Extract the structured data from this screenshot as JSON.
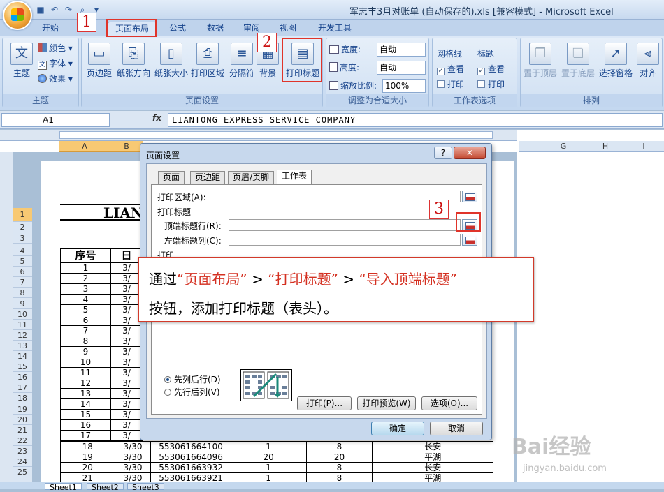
{
  "window": {
    "title": "军志丰3月对账单 (自动保存的).xls  [兼容模式] - Microsoft Excel"
  },
  "tabs": [
    "开始",
    "页面布局",
    "公式",
    "数据",
    "审阅",
    "视图",
    "开发工具"
  ],
  "active_tab": "页面布局",
  "ribbon": {
    "theme_group": {
      "label": "主题",
      "theme": "主题",
      "colors": "颜色",
      "fonts": "字体",
      "effects": "效果"
    },
    "page_setup_group": {
      "label": "页面设置",
      "margins": "页边距",
      "orientation": "纸张方向",
      "size": "纸张大小",
      "print_area": "打印区域",
      "breaks": "分隔符",
      "background": "背景",
      "print_titles": "打印标题"
    },
    "scale_group": {
      "label": "调整为合适大小",
      "width_label": "宽度:",
      "width_value": "自动",
      "height_label": "高度:",
      "height_value": "自动",
      "scale_label": "缩放比例:",
      "scale_value": "100%"
    },
    "sheet_options_group": {
      "label": "工作表选项",
      "gridlines": "网格线",
      "headings": "标题",
      "view": "查看",
      "print": "打印"
    },
    "arrange_group": {
      "label": "排列",
      "bring_front": "置于顶层",
      "send_back": "置于底层",
      "selection_pane": "选择窗格",
      "align": "对齐"
    }
  },
  "formula_bar": {
    "name_box": "A1",
    "fx": "fx",
    "formula": "LIANTONG EXPRESS SERVICE COMPANY"
  },
  "sheet": {
    "column_headers": [
      "A",
      "B",
      "G",
      "H",
      "I"
    ],
    "row_headers": [
      "1",
      "2",
      "3",
      "4",
      "5",
      "6",
      "7",
      "8",
      "9",
      "10",
      "11",
      "12",
      "13",
      "14",
      "15",
      "16",
      "17",
      "18",
      "19",
      "20",
      "21",
      "22",
      "23",
      "24",
      "25"
    ],
    "page_heading_partial": "LIAN",
    "header_cells": [
      "序号",
      "日"
    ],
    "left_cells": [
      [
        "1",
        "3/"
      ],
      [
        "2",
        "3/"
      ],
      [
        "3",
        "3/"
      ],
      [
        "4",
        "3/"
      ],
      [
        "5",
        "3/"
      ],
      [
        "6",
        "3/"
      ],
      [
        "7",
        "3/"
      ],
      [
        "8",
        "3/"
      ],
      [
        "9",
        "3/"
      ],
      [
        "10",
        "3/"
      ],
      [
        "11",
        "3/"
      ],
      [
        "12",
        "3/"
      ],
      [
        "13",
        "3/"
      ],
      [
        "14",
        "3/"
      ],
      [
        "15",
        "3/"
      ],
      [
        "16",
        "3/"
      ],
      [
        "17",
        "3/"
      ]
    ],
    "bottom_rows": [
      [
        "18",
        "3/30",
        "553061664100",
        "1",
        "8",
        "长安"
      ],
      [
        "19",
        "3/30",
        "553061664096",
        "20",
        "20",
        "平湖"
      ],
      [
        "20",
        "3/30",
        "553061663932",
        "1",
        "8",
        "长安"
      ],
      [
        "21",
        "3/30",
        "553061663921",
        "1",
        "8",
        "平湖"
      ]
    ],
    "sheet_tabs": [
      "Sheet1",
      "Sheet2",
      "Sheet3"
    ]
  },
  "dialog": {
    "title": "页面设置",
    "help": "?",
    "close": "✕",
    "tabs": [
      "页面",
      "页边距",
      "页眉/页脚",
      "工作表"
    ],
    "active_tab": "工作表",
    "print_area_label": "打印区域(A):",
    "print_titles_label": "打印标题",
    "rows_to_repeat_label": "顶端标题行(R):",
    "cols_to_repeat_label": "左端标题列(C):",
    "print_section_label": "打印",
    "order_option_1": "先列后行(D)",
    "order_option_2": "先行后列(V)",
    "btn_print": "打印(P)...",
    "btn_preview": "打印预览(W)",
    "btn_options": "选项(O)...",
    "btn_ok": "确定",
    "btn_cancel": "取消"
  },
  "callout": {
    "line1_prefix": "通过",
    "line1_a": "“页面布局”",
    "sep1": " > ",
    "line1_b": "“打印标题”",
    "sep2": " > ",
    "line1_c": "“导入顶端标题”",
    "line2": "按钮，添加打印标题（表头）。"
  },
  "markers": [
    "1",
    "2",
    "3"
  ],
  "watermark": "Bai经验",
  "watermark_sub": "jingyan.baidu.com",
  "colors": {
    "accent_red": "#e0342a",
    "ribbon_blue": "#15428b"
  }
}
